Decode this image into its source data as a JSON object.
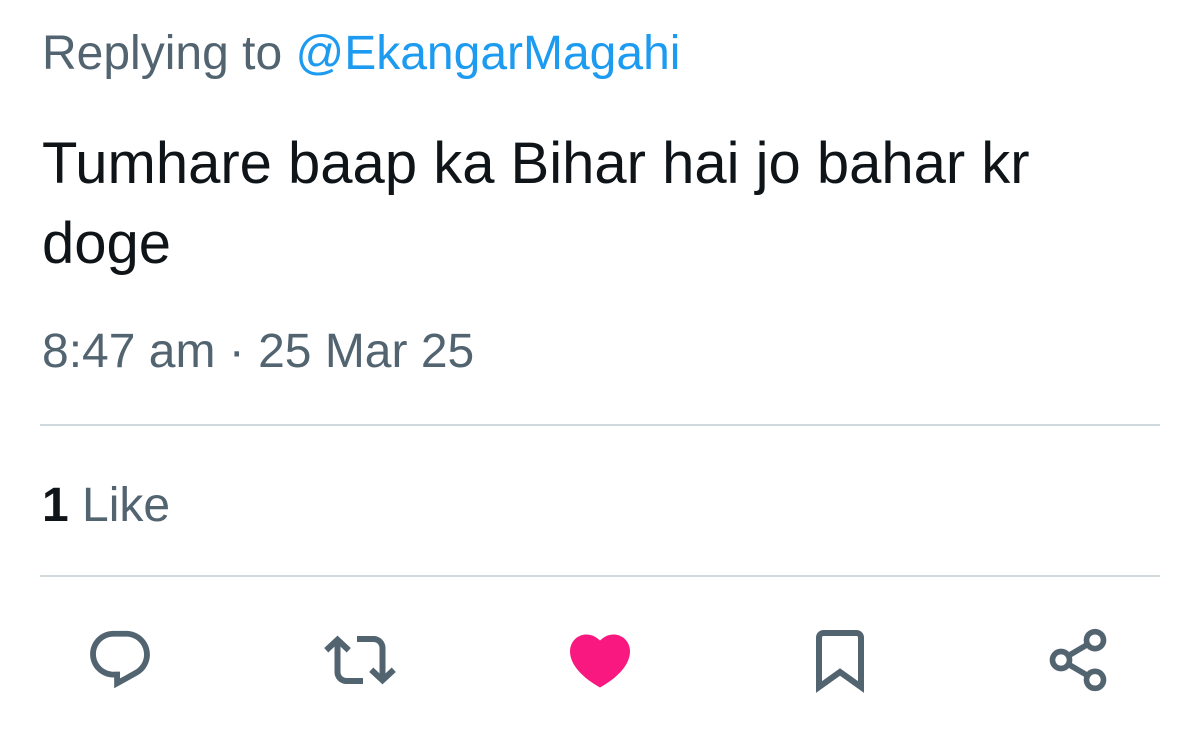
{
  "reply_context": {
    "prefix": "Replying to",
    "mention": "@EkangarMagahi"
  },
  "tweet": {
    "text": "Tumhare baap ka Bihar hai jo bahar kr doge",
    "timestamp": "8:47 am · 25 Mar 25"
  },
  "engagement": {
    "like_count": "1",
    "like_label": "Like"
  },
  "actions": [
    {
      "name": "reply",
      "icon": "reply-icon"
    },
    {
      "name": "retweet",
      "icon": "retweet-icon"
    },
    {
      "name": "like",
      "icon": "heart-icon",
      "active": true
    },
    {
      "name": "bookmark",
      "icon": "bookmark-icon"
    },
    {
      "name": "share",
      "icon": "share-icon"
    }
  ],
  "colors": {
    "text_primary": "#0f1419",
    "text_secondary": "#536471",
    "mention": "#1d9bf0",
    "divider": "#cfd9de",
    "like_active": "#f91880"
  }
}
